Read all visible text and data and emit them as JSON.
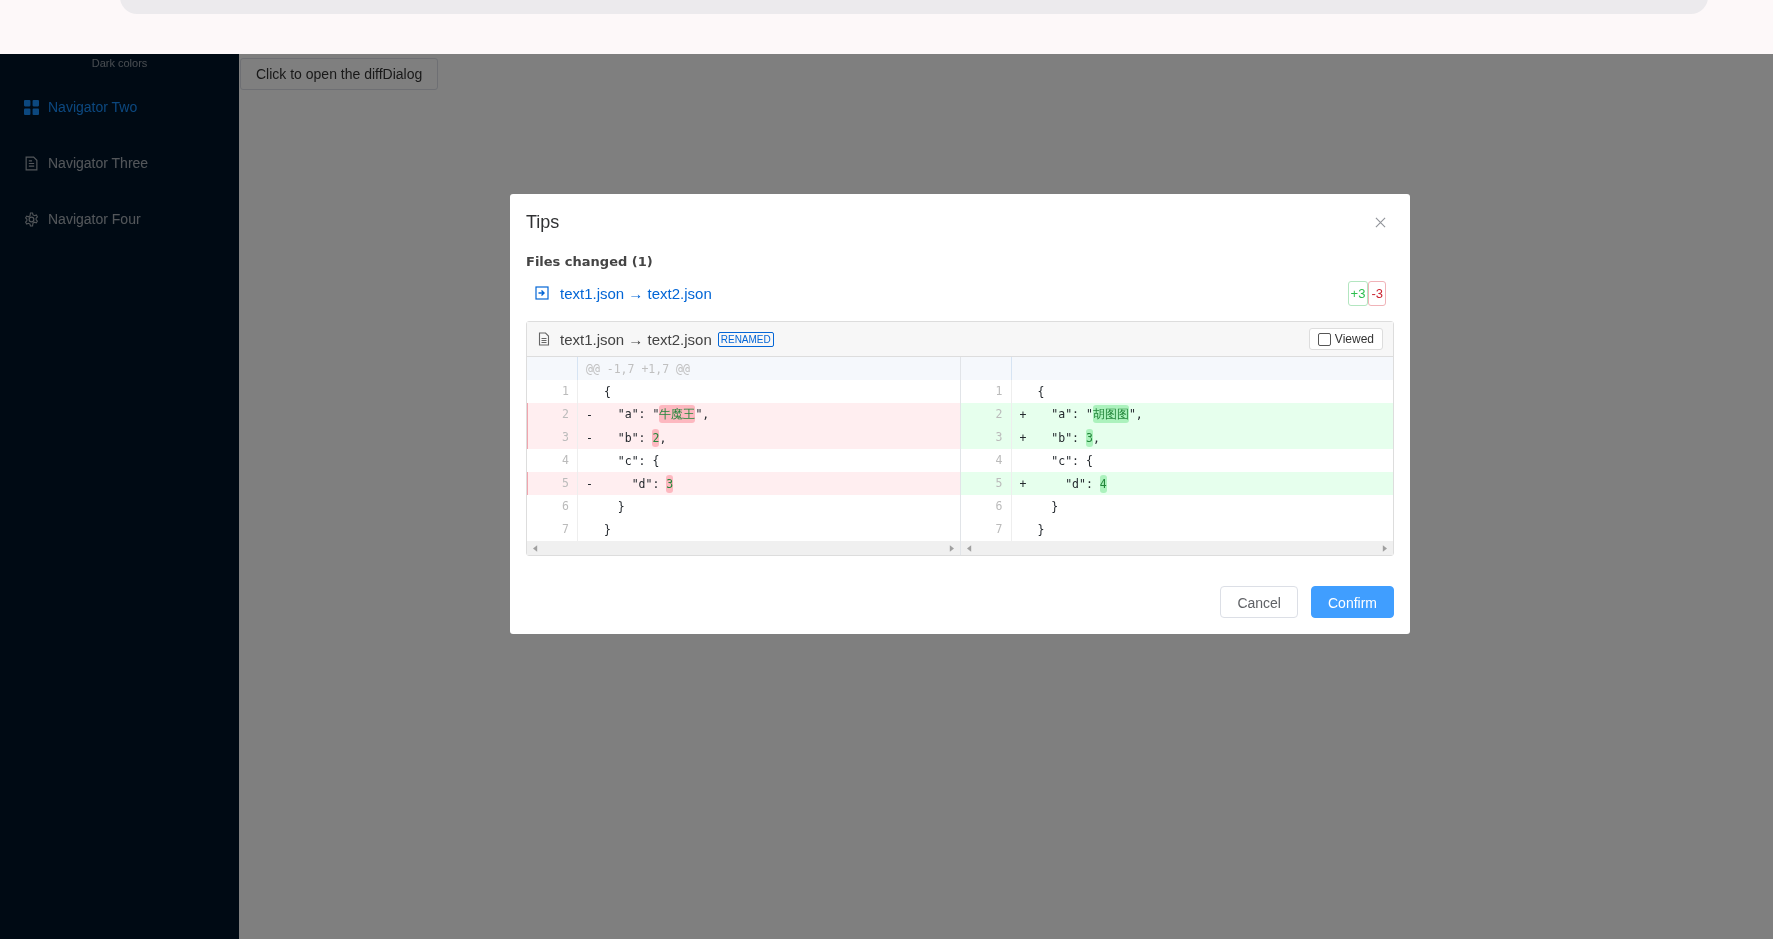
{
  "sidebar": {
    "caption": "Dark colors",
    "items": [
      {
        "label": "Navigator Two",
        "selected": true
      },
      {
        "label": "Navigator Three",
        "selected": false
      },
      {
        "label": "Navigator Four",
        "selected": false
      }
    ]
  },
  "main": {
    "open_button": "Click to open the diffDialog"
  },
  "dialog": {
    "title": "Tips",
    "files_heading": "Files changed (1)",
    "files": [
      {
        "name": "text1.json → text2.json",
        "additions": "+3",
        "deletions": "-3"
      }
    ],
    "file_diff": {
      "name": "text1.json → text2.json",
      "badge": "RENAMED",
      "viewed": {
        "label": "Viewed",
        "checked": false
      },
      "hunk": "@@ -1,7 +1,7 @@",
      "rows": [
        {
          "left": {
            "num": "1",
            "kind": "context",
            "before": "{"
          },
          "right": {
            "num": "1",
            "kind": "context",
            "before": "{"
          }
        },
        {
          "left": {
            "num": "2",
            "kind": "removed",
            "sign": "-",
            "before": "  \"a\": \"",
            "changed": "牛魔王",
            "after": "\","
          },
          "right": {
            "num": "2",
            "kind": "added",
            "sign": "+",
            "before": "  \"a\": \"",
            "changed": "胡图图",
            "after": "\","
          }
        },
        {
          "left": {
            "num": "3",
            "kind": "removed",
            "sign": "-",
            "before": "  \"b\": ",
            "changed": "2",
            "after": ","
          },
          "right": {
            "num": "3",
            "kind": "added",
            "sign": "+",
            "before": "  \"b\": ",
            "changed": "3",
            "after": ","
          }
        },
        {
          "left": {
            "num": "4",
            "kind": "context",
            "before": "  \"c\": {"
          },
          "right": {
            "num": "4",
            "kind": "context",
            "before": "  \"c\": {"
          }
        },
        {
          "left": {
            "num": "5",
            "kind": "removed",
            "sign": "-",
            "before": "    \"d\": ",
            "changed": "3"
          },
          "right": {
            "num": "5",
            "kind": "added",
            "sign": "+",
            "before": "    \"d\": ",
            "changed": "4"
          }
        },
        {
          "left": {
            "num": "6",
            "kind": "context",
            "before": "  }"
          },
          "right": {
            "num": "6",
            "kind": "context",
            "before": "  }"
          }
        },
        {
          "left": {
            "num": "7",
            "kind": "context",
            "before": "}"
          },
          "right": {
            "num": "7",
            "kind": "context",
            "before": "}"
          }
        }
      ]
    },
    "buttons": [
      {
        "label": "Cancel",
        "kind": "default"
      },
      {
        "label": "Confirm",
        "kind": "primary"
      }
    ]
  }
}
